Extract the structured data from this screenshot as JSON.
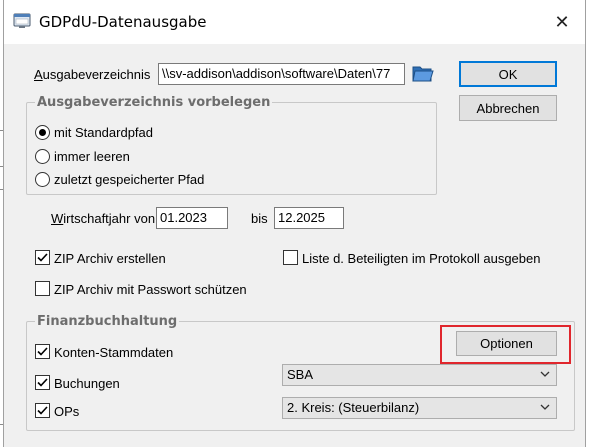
{
  "window": {
    "title": "GDPdU-Datenausgabe",
    "close_glyph": "✕",
    "icon": "app-window-icon"
  },
  "output_dir": {
    "label_mnemonic": "A",
    "label_rest": "usgabeverzeichnis",
    "value": "\\\\sv-addison\\addison\\software\\Daten\\77",
    "folder_icon": "folder-open-icon"
  },
  "buttons": {
    "ok": "OK",
    "cancel": "Abbrechen",
    "options": "Optionen"
  },
  "preset_group": {
    "title": "Ausgabeverzeichnis vorbelegen",
    "options": [
      {
        "label": "mit Standardpfad",
        "checked": true
      },
      {
        "label": "immer leeren",
        "checked": false
      },
      {
        "label": "zuletzt gespeicherter Pfad",
        "checked": false
      }
    ]
  },
  "fiscal_year": {
    "label_mnemonic": "W",
    "label_rest": "irtschaftjahr von",
    "from": "01.2023",
    "to_label": "bis",
    "to": "12.2025"
  },
  "checks": {
    "zip_create": {
      "label": "ZIP Archiv erstellen",
      "checked": true
    },
    "zip_password": {
      "label": "ZIP Archiv mit Passwort schützen",
      "checked": false
    },
    "participants_list": {
      "label": "Liste d. Beteiligten im Protokoll ausgeben",
      "checked": false
    }
  },
  "finance_group": {
    "title": "Finanzbuchhaltung",
    "items": [
      {
        "label": "Konten-Stammdaten",
        "checked": true
      },
      {
        "label": "Buchungen",
        "checked": true
      },
      {
        "label": "OPs",
        "checked": true
      }
    ],
    "combo_1": "SBA",
    "combo_2": "2. Kreis: (Steuerbilanz)"
  },
  "colors": {
    "highlight": "#e0262d",
    "default_button_border": "#0078d7"
  }
}
